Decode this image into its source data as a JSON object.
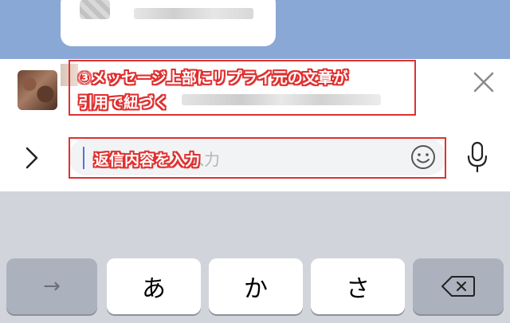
{
  "annotations": {
    "reply_note_line1": "③メッセージ上部にリプライ元の文章が",
    "reply_note_line2": "引用で紐づく",
    "input_note": "返信内容を入力"
  },
  "input": {
    "placeholder_visible": "入力"
  },
  "keyboard": {
    "key_a": "あ",
    "key_ka": "か",
    "key_sa": "さ",
    "arrow_key": "→"
  },
  "icons": {
    "close": "close-icon",
    "expand": "chevron-right-icon",
    "emoji": "emoji-icon",
    "mic": "microphone-icon",
    "delete": "delete-icon"
  },
  "colors": {
    "annotation": "#e03030",
    "chat_background": "#8aa8d6",
    "keyboard_background": "#d1d5db",
    "caret": "#5b6fd6"
  }
}
